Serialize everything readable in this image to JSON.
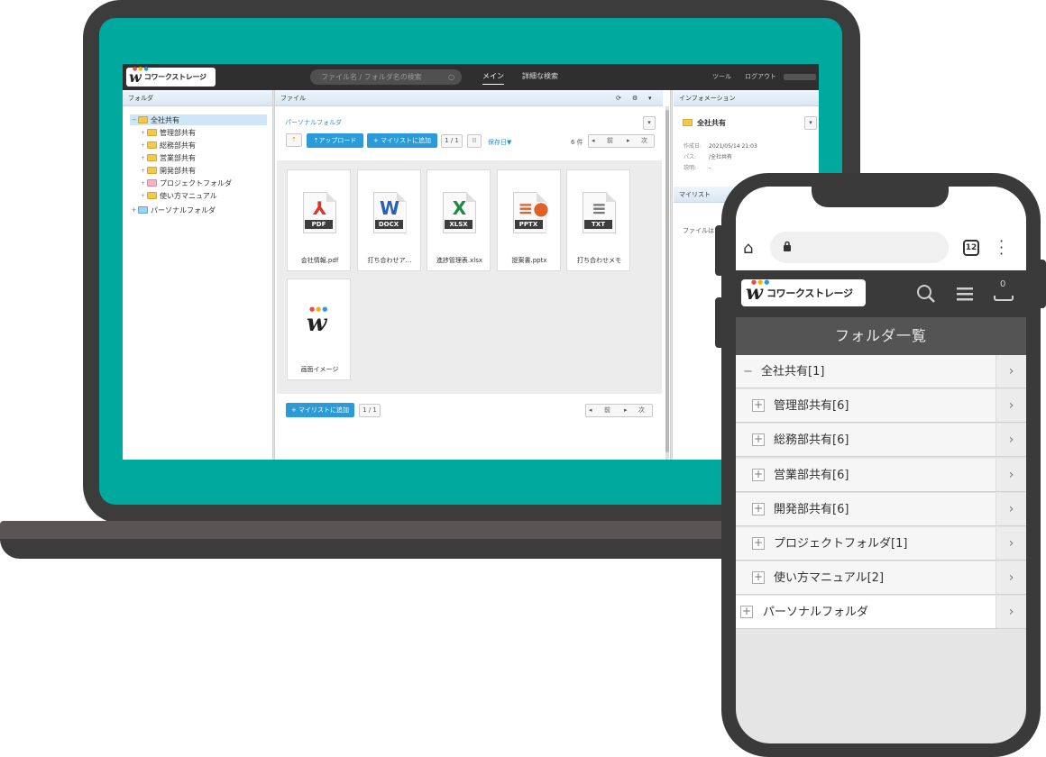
{
  "app": {
    "brand": "コワークストレージ",
    "logo_mark": "w",
    "search_placeholder": "ファイル名 / フォルダ名の検索",
    "nav": {
      "main": "メイン",
      "advanced_search": "詳細な検索",
      "tools": "ツール",
      "logout": "ログアウト"
    },
    "panels": {
      "folder": "フォルダ",
      "file": "ファイル",
      "information": "インフォメーション",
      "mylist": "マイリスト"
    },
    "tree": {
      "root": "全社共有",
      "children": [
        "管理部共有",
        "総務部共有",
        "営業部共有",
        "開発部共有",
        "プロジェクトフォルダ",
        "使い方マニュアル"
      ],
      "personal": "パーソナルフォルダ"
    },
    "toolbar": {
      "breadcrumb": "パーソナルフォルダ",
      "upload": "アップロード",
      "add_to_mylist": "マイリストに追加",
      "page": "1 / 1",
      "sort": "保存日▼",
      "count": "6 件",
      "prev": "前",
      "next": "次"
    },
    "files": [
      {
        "name": "会社情報.pdf",
        "type": "PDF",
        "glyph": "⅄",
        "color": "#d9362b"
      },
      {
        "name": "打ち合わせア…",
        "type": "DOCX",
        "glyph": "W",
        "color": "#2b5fb8"
      },
      {
        "name": "進捗管理表.xlsx",
        "type": "XLSX",
        "glyph": "X",
        "color": "#1e8a45"
      },
      {
        "name": "提案書.pptx",
        "type": "PPTX",
        "glyph": "≡●",
        "color": "#e0602a"
      },
      {
        "name": "打ち合わせメモ",
        "type": "TXT",
        "glyph": "≡",
        "color": "#777777"
      },
      {
        "name": "画面イメージ",
        "type": "",
        "glyph": "w",
        "color": "#222222"
      }
    ],
    "bottom": {
      "add_to_mylist": "マイリストに追加",
      "page": "1 / 1",
      "prev": "前",
      "next": "次"
    },
    "info": {
      "folder_name": "全社共有",
      "created_label": "作成日:",
      "created_value": "2021/05/14 21:03",
      "path_label": "パス:",
      "path_value": "/全社共有",
      "desc_label": "説明:",
      "desc_value": "-",
      "mylist_text": "ファイルは"
    }
  },
  "mobile": {
    "tab_count": "12",
    "brand": "コワークストレージ",
    "cart_count": "0",
    "title": "フォルダ一覧",
    "rows": [
      {
        "label": "全社共有[1]",
        "kind": "open"
      },
      {
        "label": "管理部共有[6]",
        "kind": "child"
      },
      {
        "label": "総務部共有[6]",
        "kind": "child"
      },
      {
        "label": "営業部共有[6]",
        "kind": "child"
      },
      {
        "label": "開発部共有[6]",
        "kind": "child"
      },
      {
        "label": "プロジェクトフォルダ[1]",
        "kind": "child"
      },
      {
        "label": "使い方マニュアル[2]",
        "kind": "child"
      },
      {
        "label": "パーソナルフォルダ",
        "kind": "top"
      }
    ]
  },
  "colors": {
    "screen_teal": "#00a99d",
    "accent_blue": "#2b9ad8",
    "dark": "#3a3a3a"
  }
}
